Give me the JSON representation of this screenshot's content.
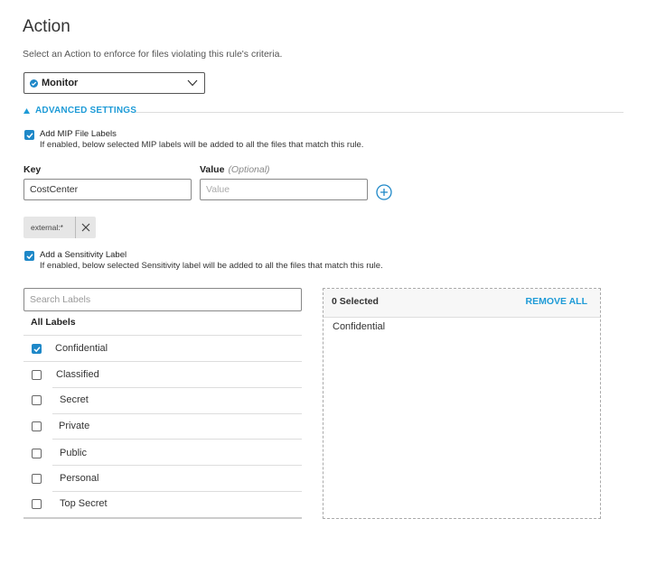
{
  "header": {
    "title": "Action",
    "subtitle": "Select an Action to enforce for files violating this rule's criteria."
  },
  "action_select": {
    "value": "Monitor",
    "icon": "monitor-icon"
  },
  "advanced": {
    "label": "ADVANCED SETTINGS",
    "accent_color": "#1e9bd7"
  },
  "mip": {
    "checked": true,
    "title": "Add MIP File Labels",
    "description": "If enabled, below selected MIP labels will be added to all the files that match this rule.",
    "key_label": "Key",
    "value_label": "Value",
    "value_optional": "(Optional)",
    "key_value": "CostCenter",
    "value_placeholder": "Value",
    "chip": "external:*"
  },
  "sensitivity": {
    "checked": true,
    "title": "Add a Sensitivity Label",
    "description": "If enabled, below selected Sensitivity label will be added to all the files that match this rule.",
    "search_placeholder": "Search Labels",
    "all_labels": "All Labels",
    "labels": [
      {
        "name": "Confidential",
        "checked": true
      },
      {
        "name": "Classified",
        "checked": false
      },
      {
        "name": "Secret",
        "checked": false
      },
      {
        "name": "Private",
        "checked": false
      },
      {
        "name": "Public",
        "checked": false
      },
      {
        "name": "Personal",
        "checked": false
      },
      {
        "name": "Top Secret",
        "checked": false
      }
    ]
  },
  "selected_panel": {
    "count_label": "0 Selected",
    "remove_all": "REMOVE ALL",
    "items": [
      "Confidential"
    ]
  }
}
